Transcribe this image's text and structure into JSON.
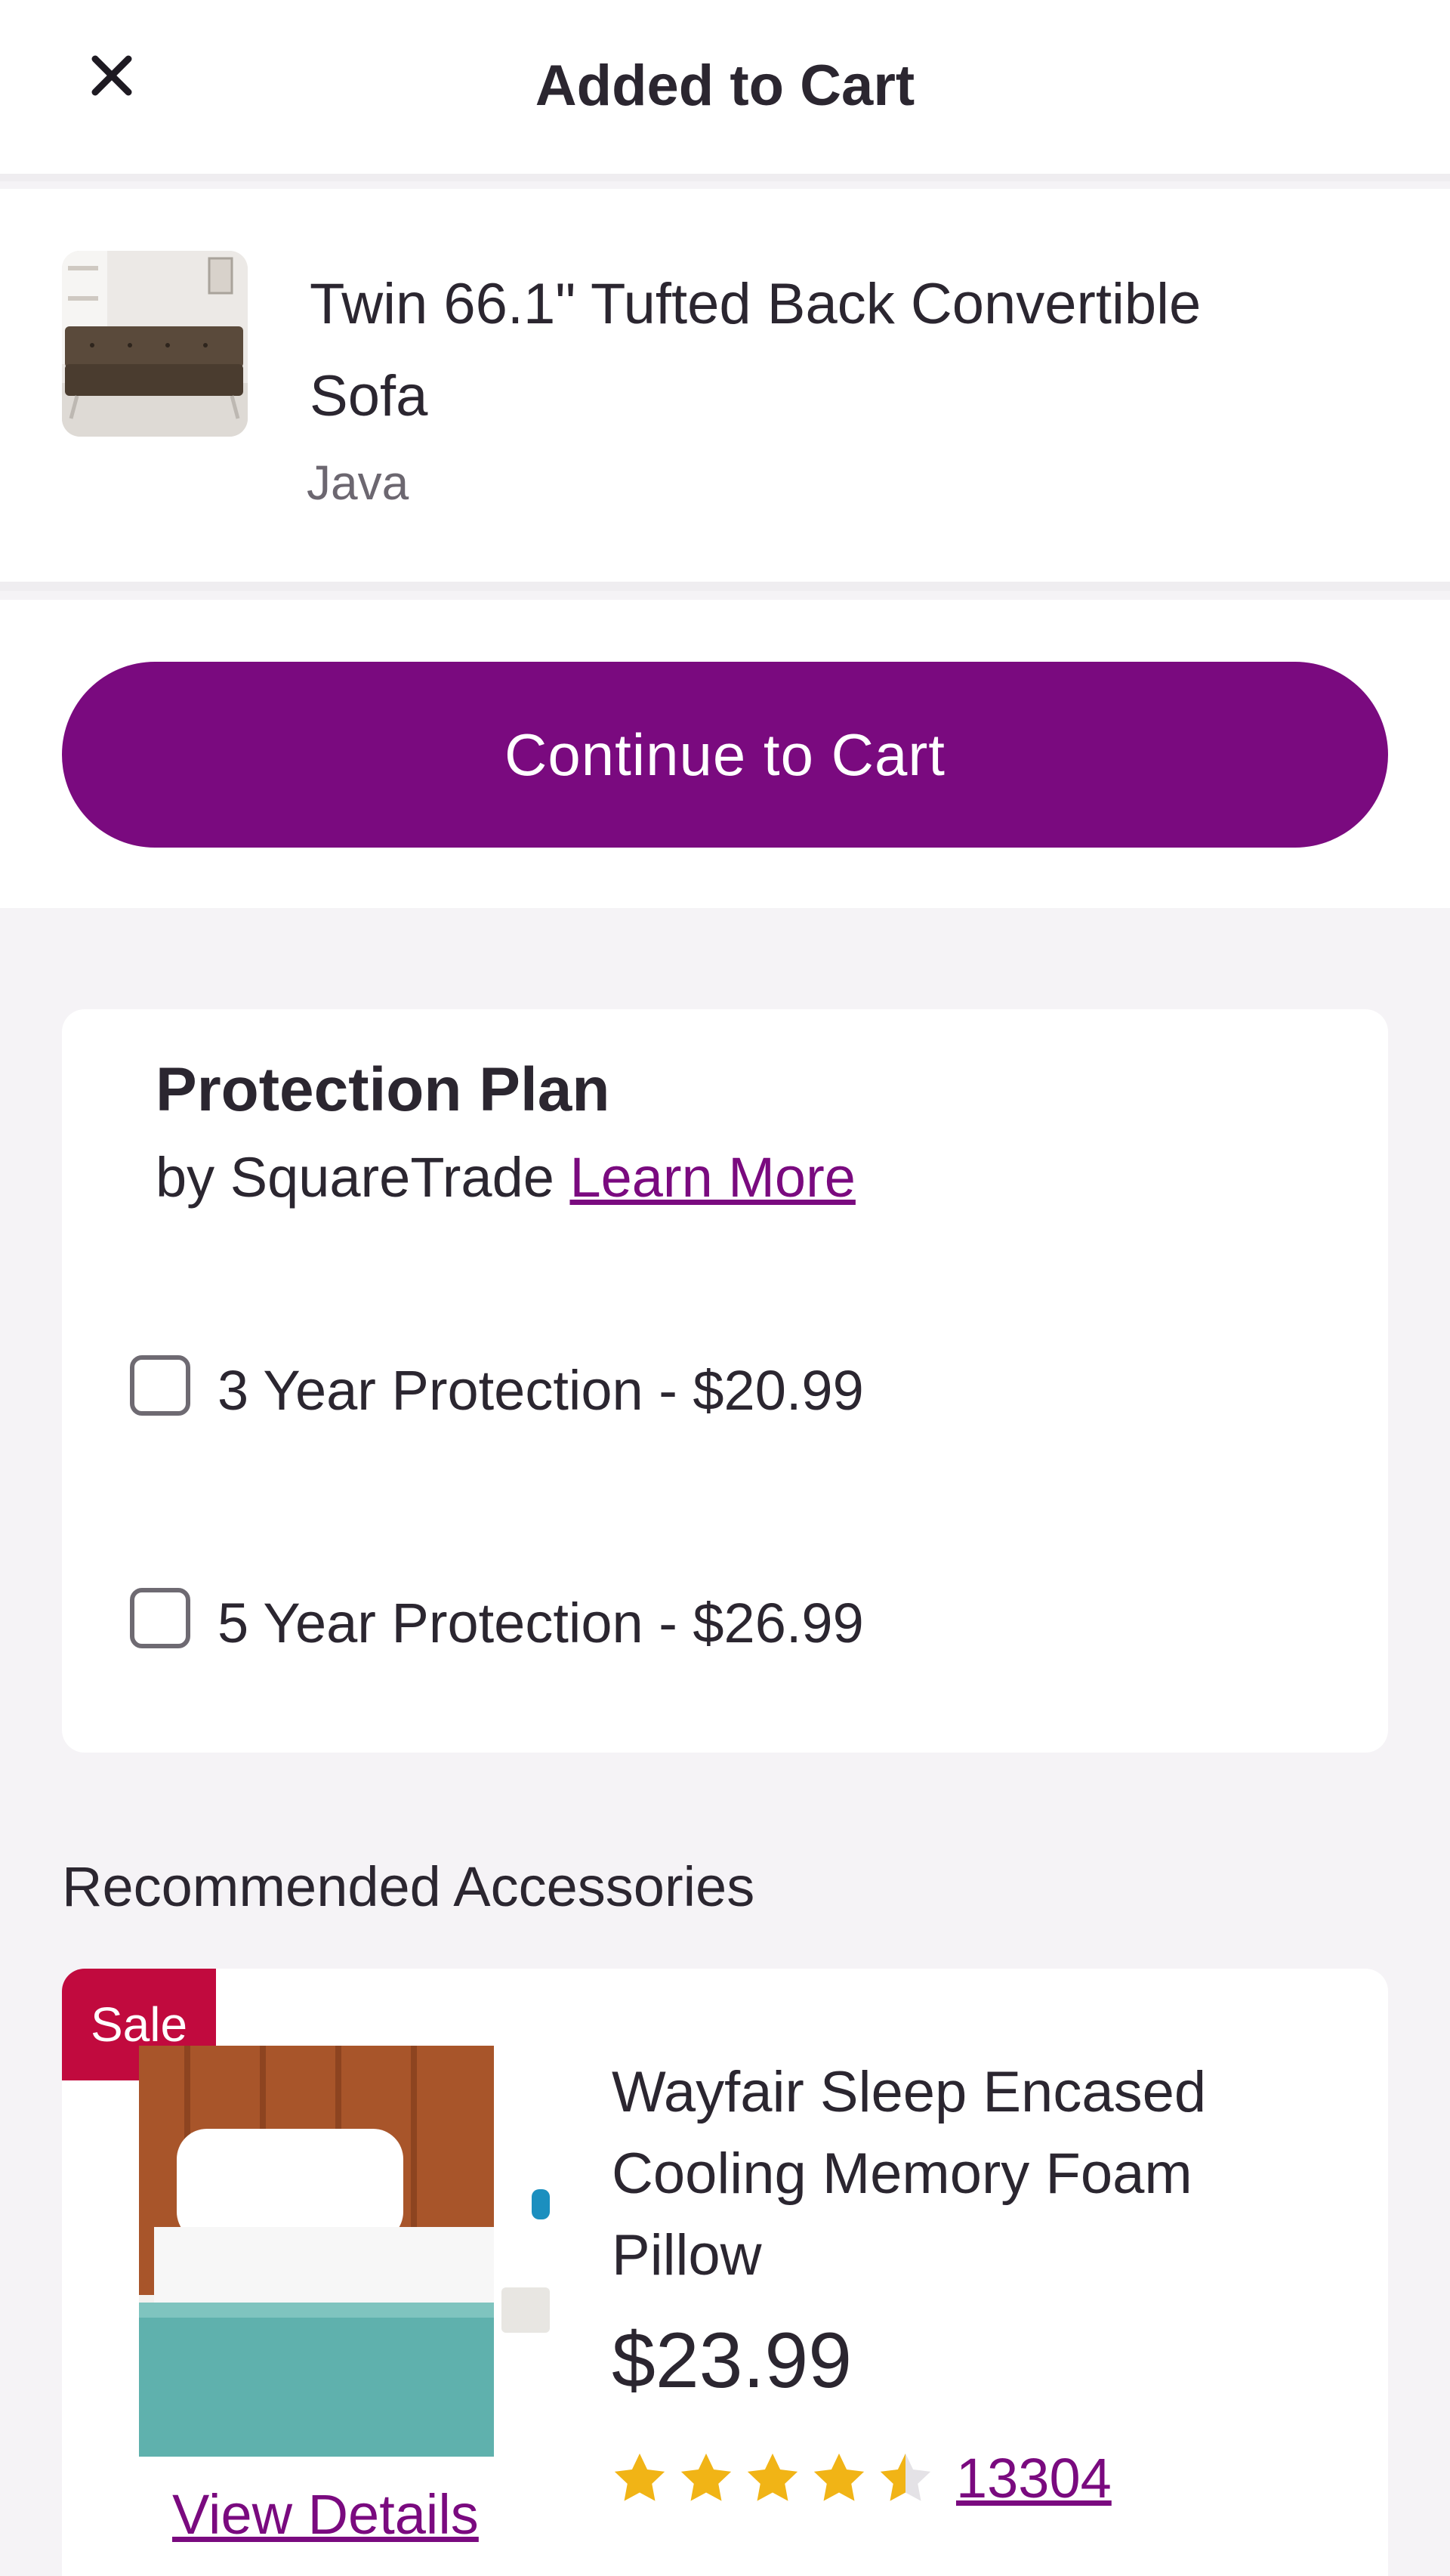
{
  "header": {
    "title": "Added to Cart",
    "close_icon": "close-icon"
  },
  "product": {
    "name": "Twin 66.1\" Tufted Back Convertible Sofa",
    "option": "Java",
    "image_icon": "sofa-thumbnail"
  },
  "cta": {
    "label": "Continue to Cart",
    "color": "#7a0a7f"
  },
  "protection_plan": {
    "title": "Protection Plan",
    "by": "by SquareTrade",
    "learn_more": "Learn More",
    "options": [
      {
        "label": "3 Year Protection - $20.99",
        "checked": false
      },
      {
        "label": "5 Year Protection - $26.99",
        "checked": false
      }
    ]
  },
  "recommended": {
    "title": "Recommended Accessories",
    "items": [
      {
        "badge": "Sale",
        "badge_color": "#c10a3e",
        "name": "Wayfair Sleep Encased Cooling Memory Foam Pillow",
        "price": "$23.99",
        "rating": 4.5,
        "review_count": "13304",
        "view_details": "View Details",
        "star_color": "#f1b416"
      }
    ]
  }
}
